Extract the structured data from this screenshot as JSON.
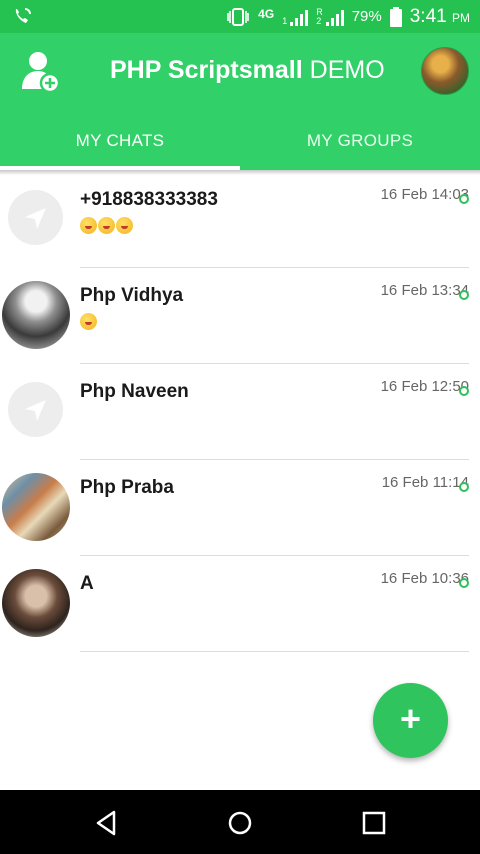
{
  "status_bar": {
    "network": "4G",
    "sim1_label": "1",
    "sim2_label": "R",
    "sim2_sub": "2",
    "battery": "79%",
    "time": "3:41",
    "ampm": "PM"
  },
  "app_bar": {
    "title_bold": "PHP Scriptsmall",
    "title_rest": "DEMO",
    "tabs": [
      {
        "label": "MY CHATS",
        "active": true
      },
      {
        "label": "MY GROUPS",
        "active": false
      }
    ]
  },
  "chats": [
    {
      "name": "+918838333383",
      "time": "16 Feb 14:03",
      "emoji_count": 3,
      "avatar": "default"
    },
    {
      "name": "Php Vidhya",
      "time": "16 Feb 13:34",
      "emoji_count": 1,
      "avatar": "photo"
    },
    {
      "name": "Php Naveen",
      "time": "16 Feb 12:50",
      "emoji_count": 0,
      "avatar": "default"
    },
    {
      "name": "Php Praba",
      "time": "16 Feb 11:14",
      "emoji_count": 0,
      "avatar": "photo"
    },
    {
      "name": "A",
      "time": "16 Feb 10:36",
      "emoji_count": 0,
      "avatar": "photo"
    }
  ],
  "fab": {
    "label": "+",
    "icon": "plus-icon"
  },
  "colors": {
    "primary": "#32d068",
    "status_bar": "#26c251",
    "fab": "#2fc45d",
    "online_dot": "#2fbf5a"
  }
}
